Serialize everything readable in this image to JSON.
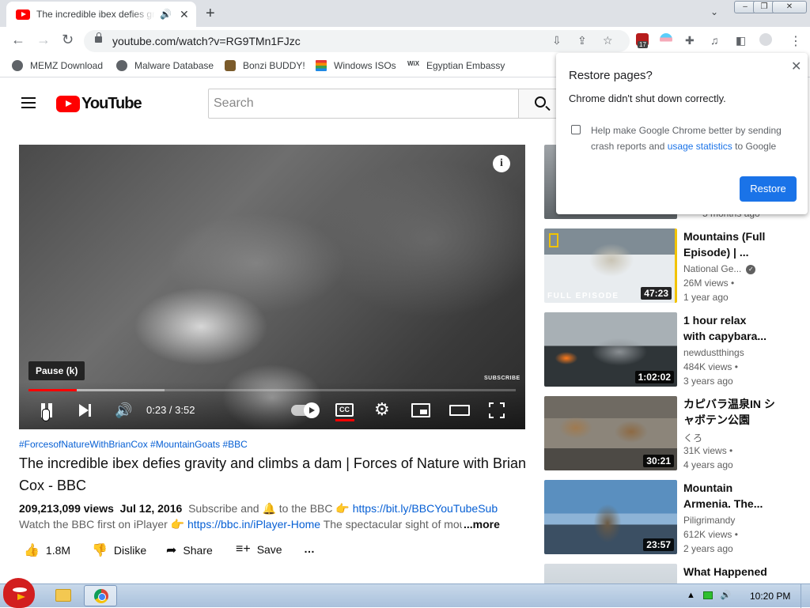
{
  "browser": {
    "tab_title": "The incredible ibex defies gravity and climbs a dam | Forces of Nature with Brian Cox - BBC",
    "tab_audio_icon": "speaker-icon",
    "new_tab_label": "+",
    "url": "youtube.com/watch?v=RG9TMn1FJzc",
    "extension_badge": "17",
    "window_buttons": [
      "minimize",
      "maximize",
      "close"
    ]
  },
  "bookmarks": [
    {
      "label": "MEMZ Download",
      "icon": "globe-icon"
    },
    {
      "label": "Malware Database",
      "icon": "globe-icon"
    },
    {
      "label": "Bonzi BUDDY!",
      "icon": "bonzi-icon"
    },
    {
      "label": "Windows ISOs",
      "icon": "windows-flag-icon"
    },
    {
      "label": "Egyptian Embassy",
      "icon": "wix-icon"
    }
  ],
  "youtube": {
    "logo_text": "YouTube",
    "search_placeholder": "Search"
  },
  "player": {
    "tooltip": "Pause (k)",
    "watermark": "SUBSCRIBE",
    "time": "0:23 / 3:52",
    "progress_played": 0.099,
    "progress_buffered": 0.28,
    "cc_label": "CC"
  },
  "video": {
    "hashtags": "#ForcesofNatureWithBrianCox #MountainGoats #BBC",
    "title": "The incredible ibex defies gravity and climbs a dam | Forces of Nature with Brian Cox - BBC",
    "views": "209,213,099 views",
    "date": "Jul 12, 2016",
    "desc_line1_text": "Subscribe and 🔔 to the BBC 👉",
    "desc_line1_link": "https://bit.ly/BBCYouTubeSub",
    "desc_line2_text": "Watch the BBC first on iPlayer 👉",
    "desc_line2_link": "https://bbc.in/iPlayer-Home",
    "desc_line2_rest": "The spectacular sight of mountain ibex",
    "more_label": "...more"
  },
  "actions": {
    "likes": "1.8M",
    "dislike": "Dislike",
    "share": "Share",
    "save": "Save",
    "more": "…"
  },
  "recommendations": [
    {
      "title": "",
      "channel": "",
      "views": "",
      "age": "5 months ago",
      "duration": ""
    },
    {
      "title": "Mountains (Full Episode) | ...",
      "channel": "National Ge...",
      "views": "26M views •",
      "age": "1 year ago",
      "duration": "47:23",
      "badge": "FULL EPISODE"
    },
    {
      "title": "1 hour relax with capybara...",
      "channel": "newdustthings",
      "views": "484K views •",
      "age": "3 years ago",
      "duration": "1:02:02"
    },
    {
      "title": "カピバラ温泉IN シャボテン公園",
      "channel": "くろ",
      "views": "31K views •",
      "age": "4 years ago",
      "duration": "30:21"
    },
    {
      "title": "Mountain Armenia. The...",
      "channel": "Piligrimandy",
      "views": "612K views •",
      "age": "2 years ago",
      "duration": "23:57"
    },
    {
      "title": "What Happened",
      "channel": "",
      "views": "",
      "age": "",
      "duration": ""
    }
  ],
  "restore_popup": {
    "title": "Restore pages?",
    "message": "Chrome didn't shut down correctly.",
    "help_text_before": "Help make Google Chrome better by sending crash reports and",
    "help_link": "usage statistics",
    "help_text_after": "to Google",
    "button": "Restore"
  },
  "taskbar": {
    "clock": "10:20 PM"
  }
}
